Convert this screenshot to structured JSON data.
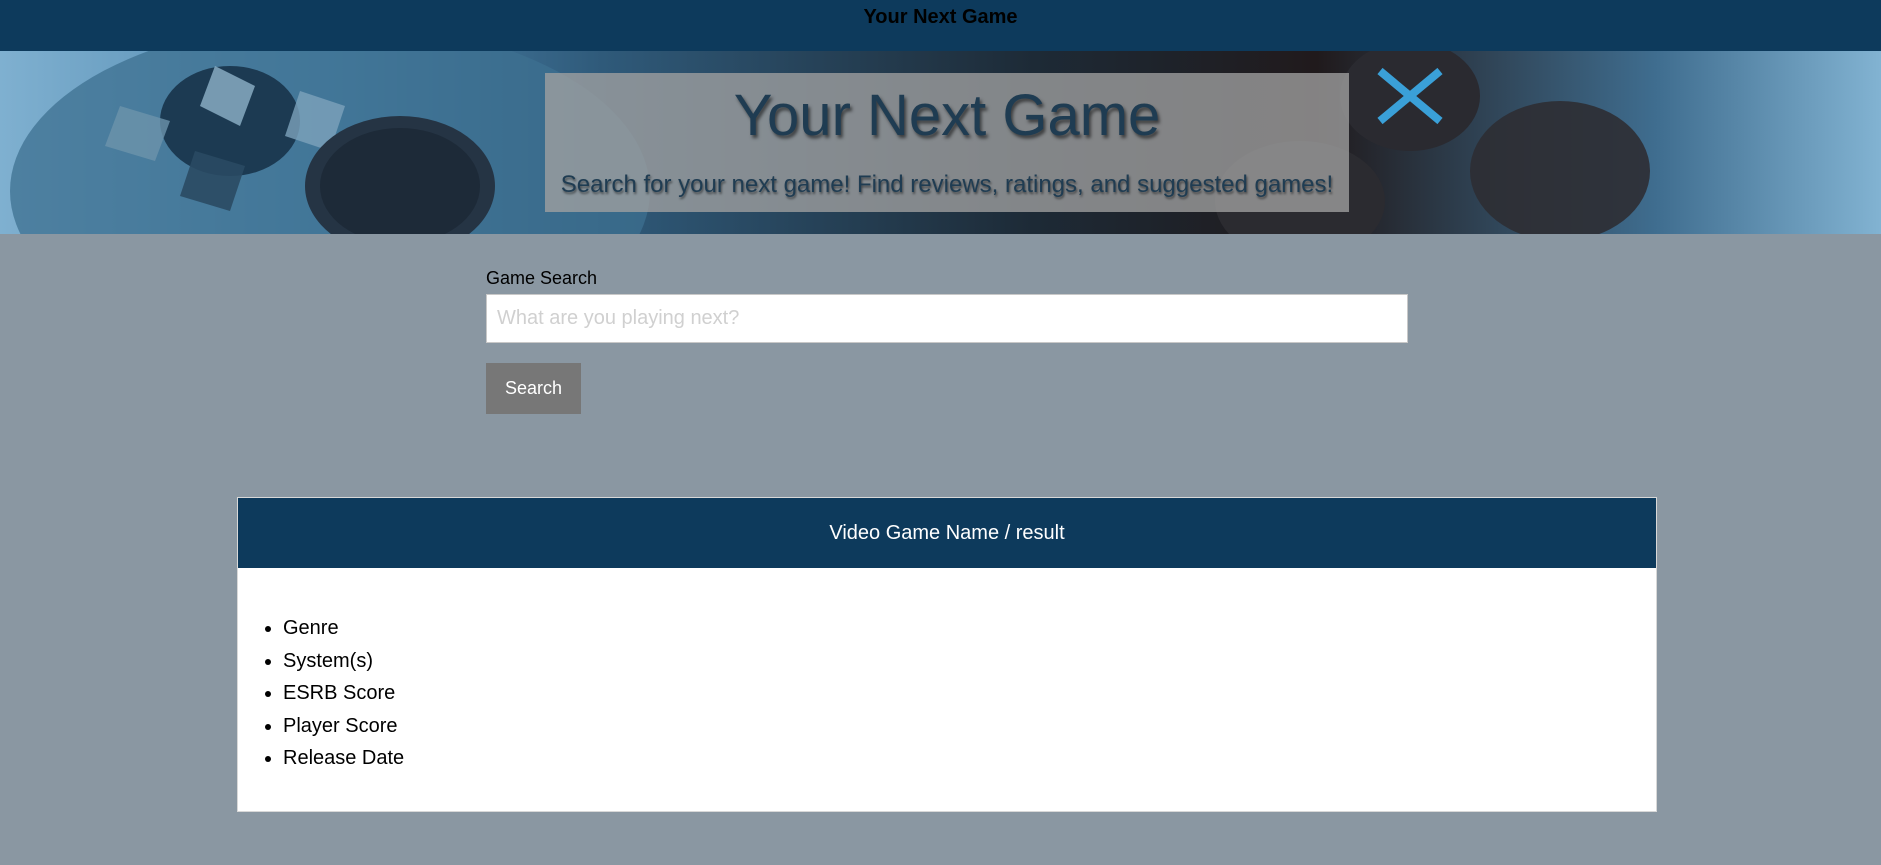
{
  "topbar": {
    "brand": "Your Next Game"
  },
  "hero": {
    "title": "Your Next Game",
    "subtitle": "Search for your next game! Find reviews, ratings, and suggested games!"
  },
  "search": {
    "label": "Game Search",
    "placeholder": "What are you playing next?",
    "value": "",
    "button_label": "Search"
  },
  "result": {
    "title": "Video Game Name / result",
    "fields": [
      "Genre",
      "System(s)",
      "ESRB Score",
      "Player Score",
      "Release Date"
    ]
  },
  "colors": {
    "navy": "#0d3a5c",
    "page_bg": "#8a97a2",
    "button_bg": "#777777"
  }
}
